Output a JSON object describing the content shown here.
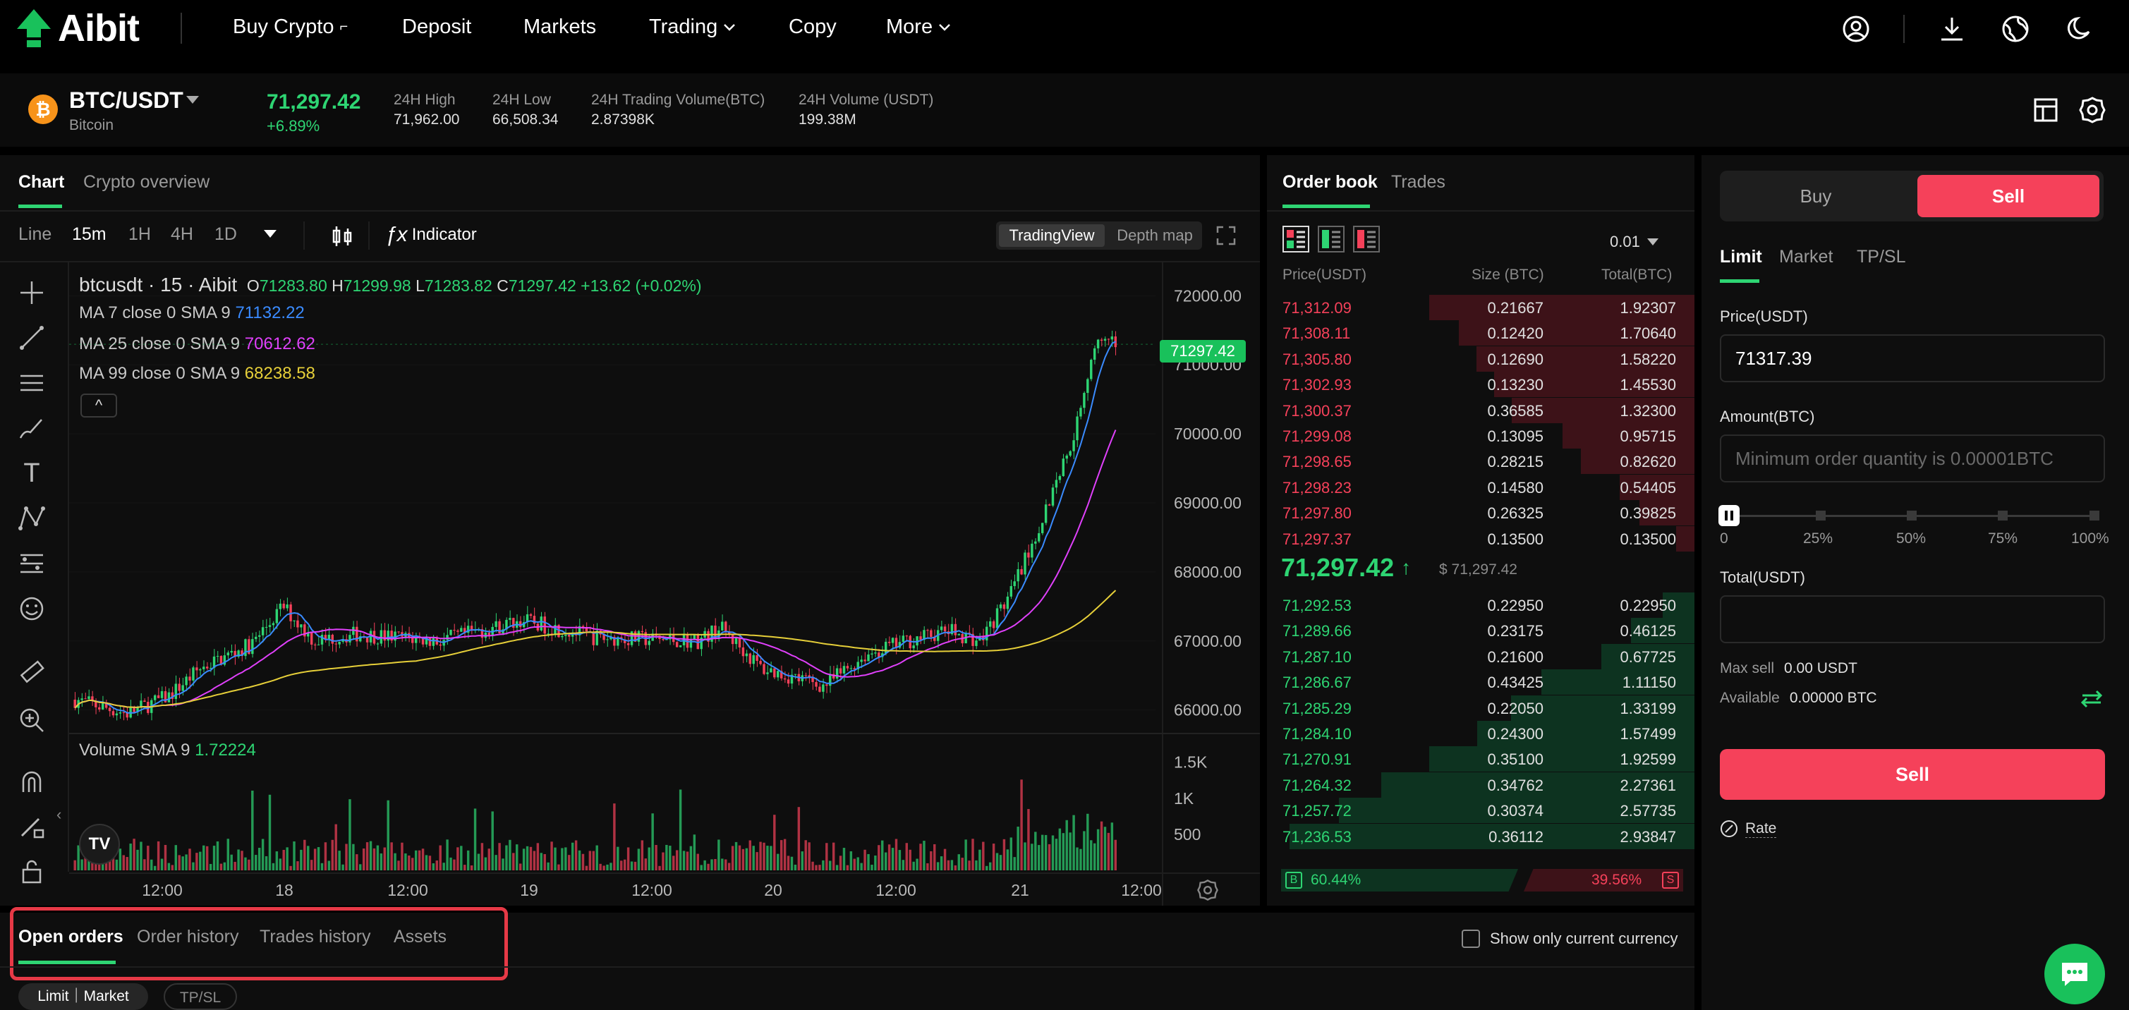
{
  "nav": {
    "logo": "Aibit",
    "items": [
      "Buy Crypto",
      "Deposit",
      "Markets",
      "Trading",
      "Copy",
      "More"
    ]
  },
  "ticker": {
    "pair": "BTC/USDT",
    "coin_name": "Bitcoin",
    "coin_glyph": "₿",
    "price": "71,297.42",
    "change": "+6.89%",
    "stats": [
      {
        "label": "24H High",
        "value": "71,962.00"
      },
      {
        "label": "24H Low",
        "value": "66,508.34"
      },
      {
        "label": "24H Trading Volume(BTC)",
        "value": "2.87398K"
      },
      {
        "label": "24H Volume (USDT)",
        "value": "199.38M"
      }
    ]
  },
  "chart_panel": {
    "tabs": [
      "Chart",
      "Crypto overview"
    ],
    "timeframes": [
      "Line",
      "15m",
      "1H",
      "4H",
      "1D"
    ],
    "selected_timeframe": "15m",
    "indicator_label": "Indicator",
    "view_toggle": [
      "TradingView",
      "Depth map"
    ]
  },
  "chart_data": {
    "type": "candlestick",
    "symbol": "btcusdt",
    "interval": "15",
    "exchange": "Aibit",
    "ohlc": {
      "O": "71283.80",
      "H": "71299.98",
      "L": "71283.82",
      "C": "71297.42",
      "change": "+13.62 (+0.02%)"
    },
    "ma": [
      {
        "label": "MA 7 close 0 SMA 9",
        "value": "71132.22",
        "color": "#3a8bff"
      },
      {
        "label": "MA 25 close 0 SMA 9",
        "value": "70612.62",
        "color": "#e040fb"
      },
      {
        "label": "MA 99 close 0 SMA 9",
        "value": "68238.58",
        "color": "#e6cf39"
      }
    ],
    "last_price_tag": "71297.42",
    "y_ticks": [
      "72000.00",
      "71000.00",
      "70000.00",
      "69000.00",
      "68000.00",
      "67000.00",
      "66000.00"
    ],
    "volume_label": "Volume SMA 9",
    "volume_value": "1.72224",
    "volume_ticks": [
      "1.5K",
      "1K",
      "500"
    ],
    "x_ticks": [
      "12:00",
      "18",
      "12:00",
      "19",
      "12:00",
      "20",
      "12:00",
      "21",
      "12:00"
    ],
    "ylim": [
      65700,
      72300
    ]
  },
  "orderbook": {
    "tabs": [
      "Order book",
      "Trades"
    ],
    "precision": "0.01",
    "headers": [
      "Price(USDT)",
      "Size (BTC)",
      "Total(BTC)"
    ],
    "asks": [
      [
        "71,312.09",
        "0.21667",
        "1.92307"
      ],
      [
        "71,308.11",
        "0.12420",
        "1.70640"
      ],
      [
        "71,305.80",
        "0.12690",
        "1.58220"
      ],
      [
        "71,302.93",
        "0.13230",
        "1.45530"
      ],
      [
        "71,300.37",
        "0.36585",
        "1.32300"
      ],
      [
        "71,299.08",
        "0.13095",
        "0.95715"
      ],
      [
        "71,298.65",
        "0.28215",
        "0.82620"
      ],
      [
        "71,298.23",
        "0.14580",
        "0.54405"
      ],
      [
        "71,297.80",
        "0.26325",
        "0.39825"
      ],
      [
        "71,297.37",
        "0.13500",
        "0.13500"
      ]
    ],
    "mid_price": "71,297.42",
    "mid_usd": "$ 71,297.42",
    "bids": [
      [
        "71,292.53",
        "0.22950",
        "0.22950"
      ],
      [
        "71,289.66",
        "0.23175",
        "0.46125"
      ],
      [
        "71,287.10",
        "0.21600",
        "0.67725"
      ],
      [
        "71,286.67",
        "0.43425",
        "1.11150"
      ],
      [
        "71,285.29",
        "0.22050",
        "1.33199"
      ],
      [
        "71,284.10",
        "0.24300",
        "1.57499"
      ],
      [
        "71,270.91",
        "0.35100",
        "1.92599"
      ],
      [
        "71,264.32",
        "0.34762",
        "2.27361"
      ],
      [
        "71,257.72",
        "0.30374",
        "2.57735"
      ],
      [
        "71,236.53",
        "0.36112",
        "2.93847"
      ]
    ],
    "buy_ratio": "60.44%",
    "sell_ratio": "39.56%",
    "buy_letter": "B",
    "sell_letter": "S"
  },
  "trade": {
    "buy": "Buy",
    "sell": "Sell",
    "order_tabs": [
      "Limit",
      "Market",
      "TP/SL"
    ],
    "price_label": "Price(USDT)",
    "price_value": "71317.39",
    "amount_label": "Amount(BTC)",
    "amount_placeholder": "Minimum order quantity is 0.00001BTC",
    "slider_marks": [
      "0",
      "25%",
      "50%",
      "75%",
      "100%"
    ],
    "total_label": "Total(USDT)",
    "max_sell_label": "Max sell",
    "max_sell_value": "0.00 USDT",
    "available_label": "Available",
    "available_value": "0.00000 BTC",
    "submit": "Sell",
    "rate": "Rate"
  },
  "bottom": {
    "tabs": [
      "Open orders",
      "Order history",
      "Trades history",
      "Assets"
    ],
    "show_only": "Show only current currency",
    "filters": [
      "Limit｜Market",
      "TP/SL"
    ]
  }
}
